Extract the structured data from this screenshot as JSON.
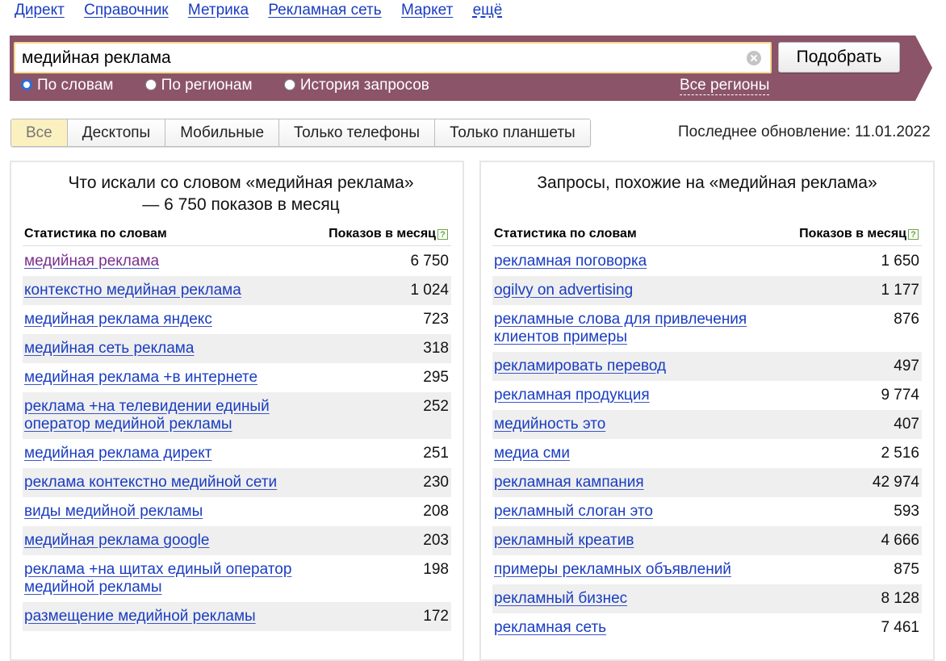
{
  "nav": [
    "Директ",
    "Справочник",
    "Метрика",
    "Рекламная сеть",
    "Маркет",
    "ещё"
  ],
  "search": {
    "value": "медийная реклама",
    "button": "Подобрать",
    "modes": [
      "По словам",
      "По регионам",
      "История запросов"
    ],
    "selected_mode": "По словам",
    "regions_link": "Все регионы"
  },
  "tabs": [
    "Все",
    "Десктопы",
    "Мобильные",
    "Только телефоны",
    "Только планшеты"
  ],
  "active_tab": "Все",
  "updated": "Последнее обновление: 11.01.2022",
  "colors": {
    "band": "#8c5468",
    "link": "#1a3dc1",
    "visited": "#7a2f8e",
    "active_tab": "#fbf0c0"
  },
  "left_panel": {
    "title": "Что искали со словом «медийная реклама» — 6 750 показов в месяц",
    "col1": "Статистика по словам",
    "col2": "Показов в месяц",
    "rows": [
      {
        "kw": "медийная реклама",
        "n": "6 750"
      },
      {
        "kw": "контекстно медийная реклама",
        "n": "1 024"
      },
      {
        "kw": "медийная реклама яндекс",
        "n": "723"
      },
      {
        "kw": "медийная сеть реклама",
        "n": "318"
      },
      {
        "kw": "медийная реклама +в интернете",
        "n": "295"
      },
      {
        "kw": "реклама +на телевидении единый оператор медийной рекламы",
        "n": "252"
      },
      {
        "kw": "медийная реклама директ",
        "n": "251"
      },
      {
        "kw": "реклама контекстно медийной сети",
        "n": "230"
      },
      {
        "kw": "виды медийной рекламы",
        "n": "208"
      },
      {
        "kw": "медийная реклама google",
        "n": "203"
      },
      {
        "kw": "реклама +на щитах единый оператор медийной рекламы",
        "n": "198"
      },
      {
        "kw": "размещение медийной рекламы",
        "n": "172"
      }
    ]
  },
  "right_panel": {
    "title": "Запросы, похожие на «медийная реклама»",
    "col1": "Статистика по словам",
    "col2": "Показов в месяц",
    "rows": [
      {
        "kw": "рекламная поговорка",
        "n": "1 650"
      },
      {
        "kw": "ogilvy on advertising",
        "n": "1 177"
      },
      {
        "kw": "рекламные слова для привлечения клиентов примеры",
        "n": "876"
      },
      {
        "kw": "рекламировать перевод",
        "n": "497"
      },
      {
        "kw": "рекламная продукция",
        "n": "9 774"
      },
      {
        "kw": "медийность это",
        "n": "407"
      },
      {
        "kw": "медиа сми",
        "n": "2 516"
      },
      {
        "kw": "рекламная кампания",
        "n": "42 974"
      },
      {
        "kw": "рекламный слоган это",
        "n": "593"
      },
      {
        "kw": "рекламный креатив",
        "n": "4 666"
      },
      {
        "kw": "примеры рекламных объявлений",
        "n": "875"
      },
      {
        "kw": "рекламный бизнес",
        "n": "8 128"
      },
      {
        "kw": "рекламная сеть",
        "n": "7 461"
      }
    ]
  }
}
